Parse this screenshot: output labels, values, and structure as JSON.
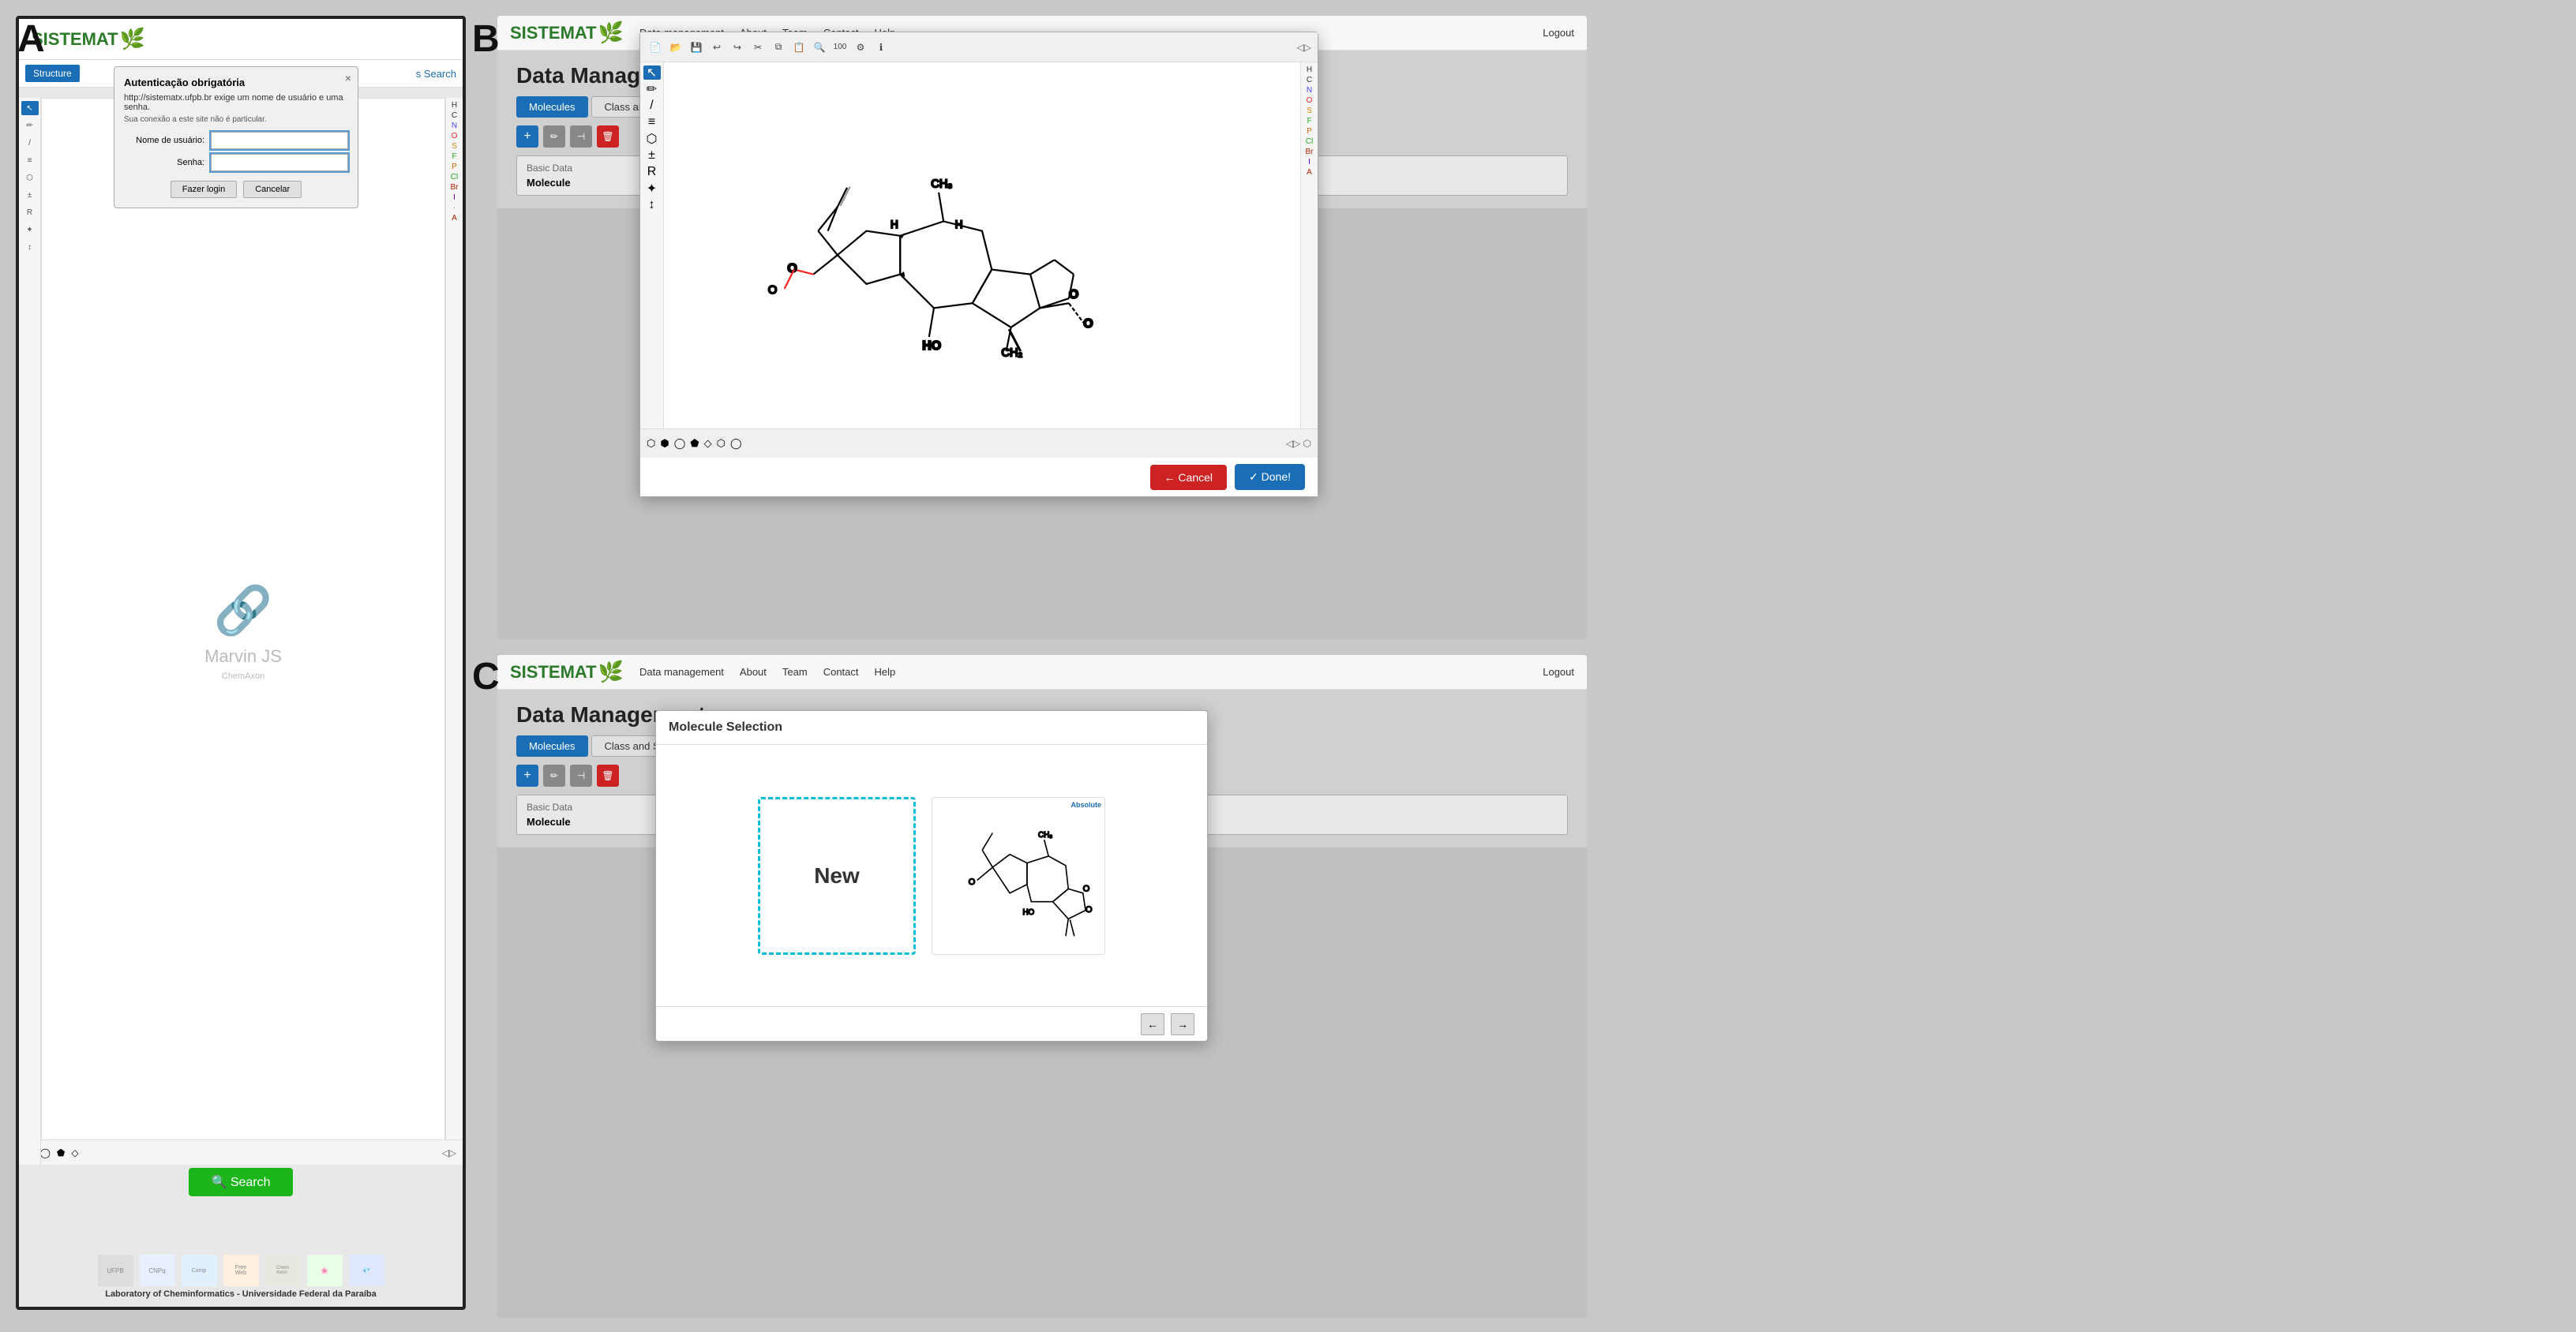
{
  "labels": {
    "a": "A",
    "b": "B",
    "c": "C"
  },
  "panel_a": {
    "logo": "SISTEMAT",
    "auth_dialog": {
      "title": "Autenticação obrigatória",
      "message": "http://sistematx.ufpb.br exige um nome de usuário e uma senha.",
      "sub": "Sua conexão a este site não é particular.",
      "username_label": "Nome de usuário:",
      "password_label": "Senha:",
      "login_btn": "Fazer login",
      "cancel_btn": "Cancelar",
      "close": "×"
    },
    "structure_btn": "Structure",
    "search_link": "s Search",
    "marvin_text": "Marvin JS",
    "chemaxon_text": "ChemAxon",
    "search_btn": "🔍 Search",
    "caption": "Laboratory of Cheminformatics - Universidade Federal da Paraíba",
    "elements": [
      "H",
      "C",
      "N",
      "O",
      "S",
      "F",
      "P",
      "Cl",
      "Br",
      "I",
      "·",
      "A"
    ]
  },
  "panel_b": {
    "logo": "SISTEMAT",
    "nav_items": [
      "Data management",
      "About",
      "Team",
      "Contact",
      "Help"
    ],
    "logout": "Logout",
    "title": "Data Management",
    "tabs": [
      "Molecules",
      "Class and Skeleton"
    ],
    "actions": [
      "+",
      "✏",
      "⊣",
      "🗑"
    ],
    "basic_data_title": "Basic Data",
    "molecule_label": "Molecule",
    "modal_footer": {
      "cancel_btn": "← Cancel",
      "done_btn": "✓ Done!"
    },
    "elements": [
      "H",
      "C",
      "N",
      "O",
      "S",
      "F",
      "P",
      "Cl",
      "Br",
      "I",
      "A"
    ]
  },
  "panel_c": {
    "logo": "SISTEMAT",
    "nav_items": [
      "Data management",
      "About",
      "Team",
      "Contact",
      "Help"
    ],
    "logout": "Logout",
    "title": "Data Management",
    "tabs": [
      "Molecules",
      "Class and Skeleton"
    ],
    "basic_data_title": "Basic Data",
    "molecule_label": "Molecule",
    "mol_selection": {
      "title": "Molecule Selection",
      "new_label": "New",
      "absolute_label": "Absolute",
      "nav_prev": "←",
      "nav_next": "→"
    }
  }
}
